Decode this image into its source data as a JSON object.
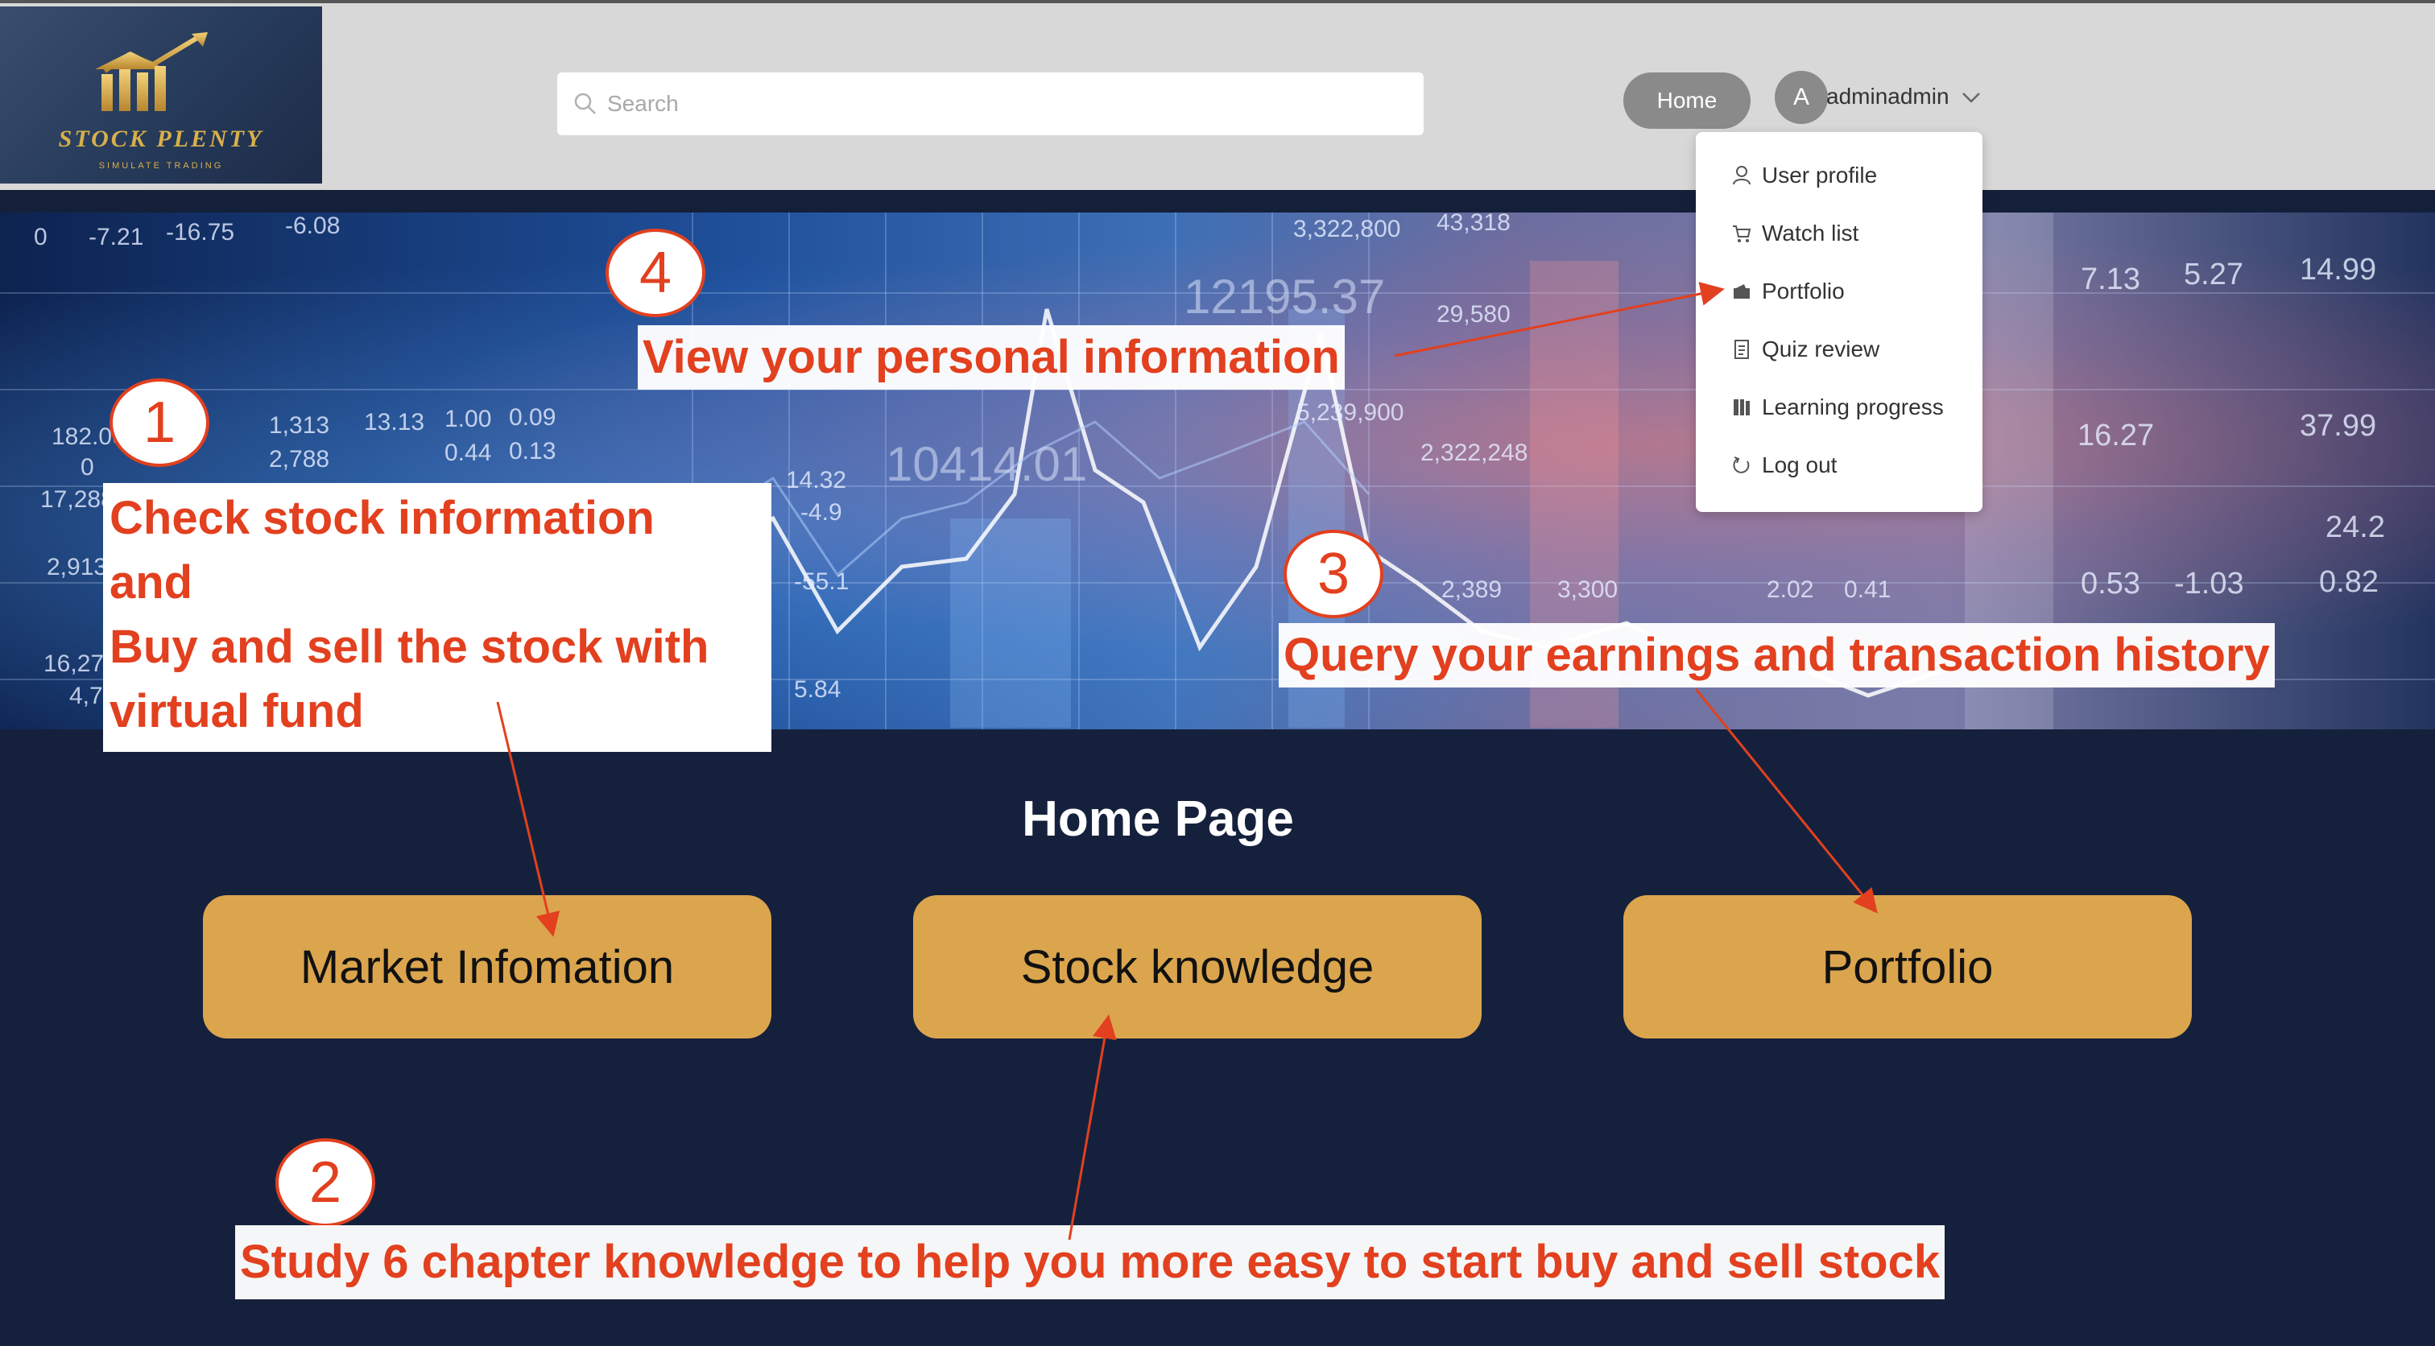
{
  "header": {
    "logo": {
      "title": "STOCK PLENTY",
      "subtitle": "SIMULATE TRADING"
    },
    "search": {
      "placeholder": "Search"
    },
    "home_button": "Home",
    "user": {
      "avatar_letter": "A",
      "name": "adminadmin"
    }
  },
  "user_menu": {
    "items": [
      {
        "label": "User profile",
        "icon": "user-icon"
      },
      {
        "label": "Watch list",
        "icon": "cart-icon"
      },
      {
        "label": "Portfolio",
        "icon": "wallet-icon"
      },
      {
        "label": "Quiz review",
        "icon": "document-icon"
      },
      {
        "label": "Learning progress",
        "icon": "book-icon"
      },
      {
        "label": "Log out",
        "icon": "logout-icon"
      }
    ]
  },
  "hero": {
    "numbers": [
      "0",
      "-7.21",
      "-16.75",
      "-6.08",
      "182.00",
      "0",
      "17,288",
      "2,913",
      "16,273",
      "4,70",
      "1,313",
      "2,788",
      "13.13",
      "1.00",
      "0.44",
      "0.09",
      "0.13",
      "14.32",
      "-4.9",
      "-55.1",
      "5.84",
      "3,322,800",
      "43,318",
      "29,580",
      "5,239,900",
      "2,322,248",
      "2,389",
      "3,300",
      "2.02",
      "0.41",
      "7.13",
      "5.27",
      "14.99",
      "16.27",
      "37.99",
      "24.2",
      "0.53",
      "-1.03",
      "0.82"
    ],
    "big_numbers": [
      "12195.37",
      "10414.01"
    ]
  },
  "annotations": {
    "step1": {
      "number": "1",
      "text": [
        "Check stock information",
        "and",
        "Buy and sell the stock with",
        "virtual fund"
      ]
    },
    "step2": {
      "number": "2",
      "text": "Study 6 chapter knowledge to help you more easy to start buy and sell stock"
    },
    "step3": {
      "number": "3",
      "text": "Query your earnings and transaction history"
    },
    "step4": {
      "number": "4",
      "text": "View your personal information"
    }
  },
  "main": {
    "title": "Home Page",
    "buttons": [
      "Market Infomation",
      "Stock knowledge",
      "Portfolio"
    ]
  },
  "colors": {
    "navy": "#15213c",
    "button_gold": "#dba54e",
    "annotation_red": "#e2401f",
    "header_gray": "#d8d8d8",
    "pill_gray": "#8a8a8a"
  }
}
